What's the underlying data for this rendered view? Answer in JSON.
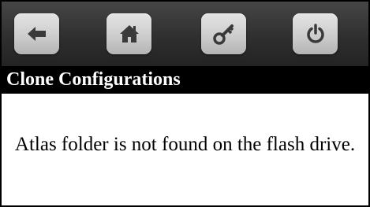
{
  "toolbar": {
    "buttons": [
      {
        "id": "back",
        "icon": "arrow-left-icon"
      },
      {
        "id": "home",
        "icon": "home-icon"
      },
      {
        "id": "key",
        "icon": "key-icon"
      },
      {
        "id": "power",
        "icon": "power-icon"
      }
    ],
    "icon_color": "#3a3a3a"
  },
  "screen": {
    "title": "Clone Configurations",
    "message": "Atlas folder is not found on the flash drive."
  },
  "colors": {
    "toolbar_bg": "#2f2f2f",
    "title_bar_bg": "#000000",
    "title_text": "#ffffff",
    "button_face": "#cdcdcd"
  }
}
